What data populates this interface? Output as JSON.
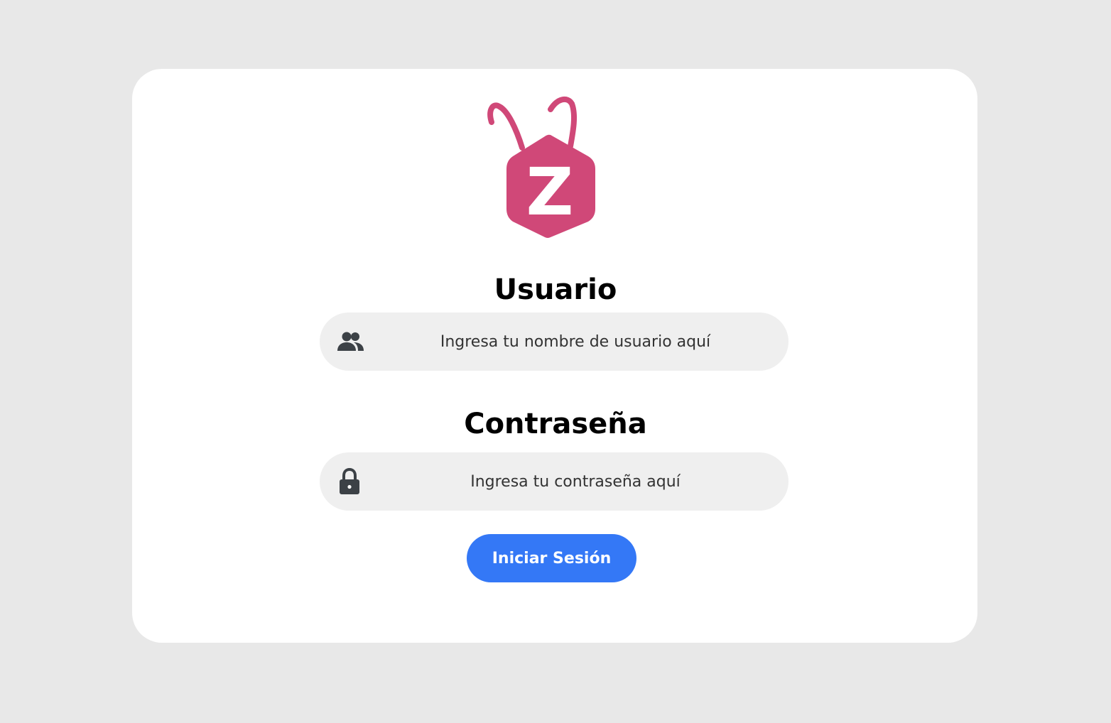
{
  "brand": {
    "logo_letter": "Z",
    "logo_icon": "z-bug-logo-icon",
    "logo_color": "#d04878"
  },
  "form": {
    "username_label": "Usuario",
    "username_placeholder": "Ingresa tu nombre de usuario aquí",
    "username_value": "",
    "username_icon": "users-icon",
    "password_label": "Contraseña",
    "password_placeholder": "Ingresa tu contraseña aquí",
    "password_value": "",
    "password_icon": "lock-icon",
    "submit_label": "Iniciar Sesión"
  },
  "colors": {
    "background": "#e8e8e8",
    "card": "#ffffff",
    "field": "#efefef",
    "icon": "#3c4146",
    "button": "#3478f6",
    "button_text": "#ffffff"
  }
}
